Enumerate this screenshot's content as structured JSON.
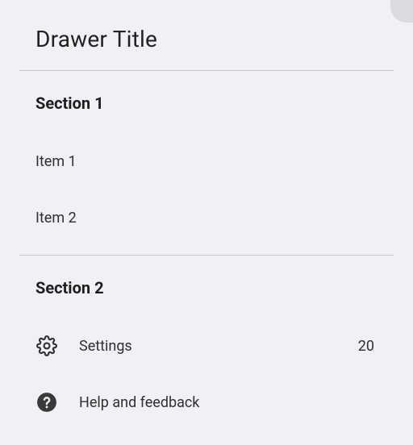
{
  "drawer": {
    "title": "Drawer Title",
    "sections": [
      {
        "label": "Section 1",
        "items": [
          {
            "label": "Item 1"
          },
          {
            "label": "Item 2"
          }
        ]
      },
      {
        "label": "Section 2",
        "items": [
          {
            "label": "Settings",
            "icon": "gear-icon",
            "badge": "20"
          },
          {
            "label": "Help and feedback",
            "icon": "help-icon"
          }
        ]
      }
    ]
  }
}
